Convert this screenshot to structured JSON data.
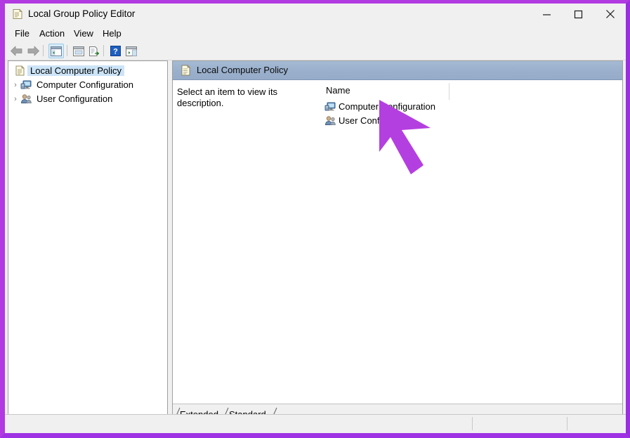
{
  "window": {
    "title": "Local Group Policy Editor",
    "title_icon": "policy-scroll-icon",
    "controls": {
      "minimize": "minimize-icon",
      "maximize": "maximize-icon",
      "close": "close-icon"
    }
  },
  "menubar": {
    "items": [
      {
        "label": "File"
      },
      {
        "label": "Action"
      },
      {
        "label": "View"
      },
      {
        "label": "Help"
      }
    ]
  },
  "toolbar": {
    "buttons": [
      {
        "name": "back-button",
        "icon": "left-arrow-icon",
        "selected": false
      },
      {
        "name": "forward-button",
        "icon": "right-arrow-icon",
        "selected": false
      },
      {
        "name": "show-hide-console-tree-button",
        "icon": "console-tree-icon",
        "selected": true
      },
      {
        "name": "properties-button",
        "icon": "properties-window-icon",
        "selected": false
      },
      {
        "name": "export-list-button",
        "icon": "export-list-icon",
        "selected": false
      },
      {
        "name": "help-button",
        "icon": "question-mark-icon",
        "selected": false
      },
      {
        "name": "show-hide-action-pane-button",
        "icon": "action-pane-icon",
        "selected": false
      }
    ]
  },
  "tree": {
    "items": [
      {
        "label": "Local Computer Policy",
        "icon": "policy-scroll-icon",
        "selected": true,
        "expander": "",
        "indent": 8
      },
      {
        "label": "Computer Configuration",
        "icon": "computer-icon",
        "selected": false,
        "expander": "›",
        "indent": 10
      },
      {
        "label": "User Configuration",
        "icon": "user-icon",
        "selected": false,
        "expander": "›",
        "indent": 10
      }
    ]
  },
  "detail": {
    "header": {
      "title": "Local Computer Policy",
      "icon": "policy-scroll-icon"
    },
    "description": "Select an item to view its description.",
    "columns": [
      "Name"
    ],
    "rows": [
      {
        "name": "Computer Configuration",
        "icon": "computer-icon"
      },
      {
        "name": "User Configuration",
        "icon": "user-icon"
      }
    ]
  },
  "tabs": [
    {
      "label": "Extended",
      "active": false
    },
    {
      "label": "Standard",
      "active": true
    }
  ],
  "statusbar": {
    "segments": [
      "",
      "",
      ""
    ]
  },
  "annotation": {
    "cursor": "mouse-pointer-arrow",
    "color": "#b43fe0"
  },
  "colors": {
    "frame": "#b13ae0",
    "header_band": "#9ab0cc",
    "selection": "#cce4f7",
    "cursor": "#b43fe0"
  }
}
